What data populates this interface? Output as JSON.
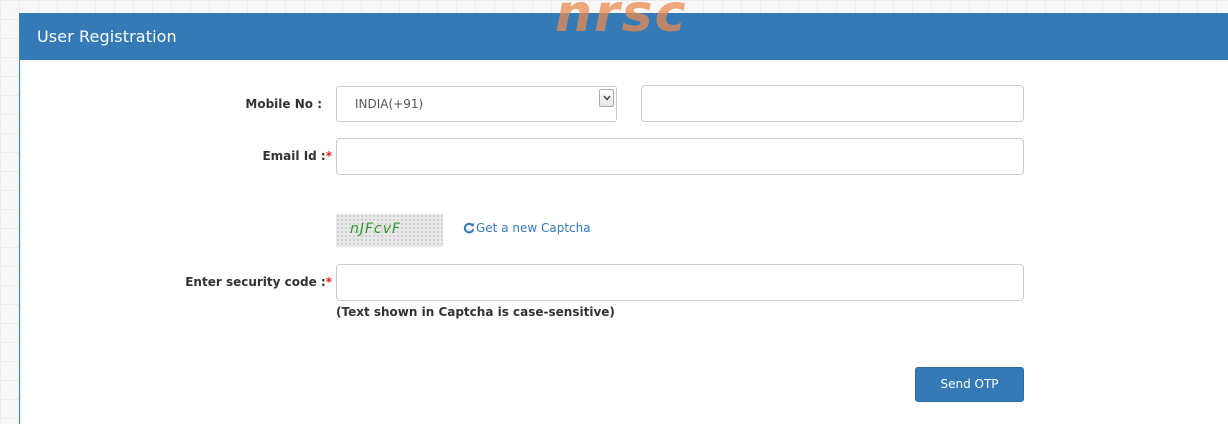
{
  "watermark": "nrsc",
  "panel": {
    "title": "User Registration"
  },
  "form": {
    "mobile": {
      "label": "Mobile No :",
      "country_selected": "INDIA(+91)",
      "number_value": ""
    },
    "email": {
      "label": "Email Id :",
      "required_marker": "*",
      "value": ""
    },
    "captcha": {
      "text": "nJFcvF",
      "refresh_link": "Get a new Captcha"
    },
    "security_code": {
      "label": "Enter security code :",
      "required_marker": "*",
      "value": "",
      "hint": "(Text shown in Captcha is case-sensitive)"
    },
    "submit_label": "Send OTP"
  },
  "colors": {
    "header": "#337ab7",
    "link": "#337ab7",
    "required": "#e02020",
    "captcha_text": "#2e9a2e"
  },
  "icons": {
    "refresh": "refresh-icon",
    "dropdown": "chevron-down-icon"
  }
}
